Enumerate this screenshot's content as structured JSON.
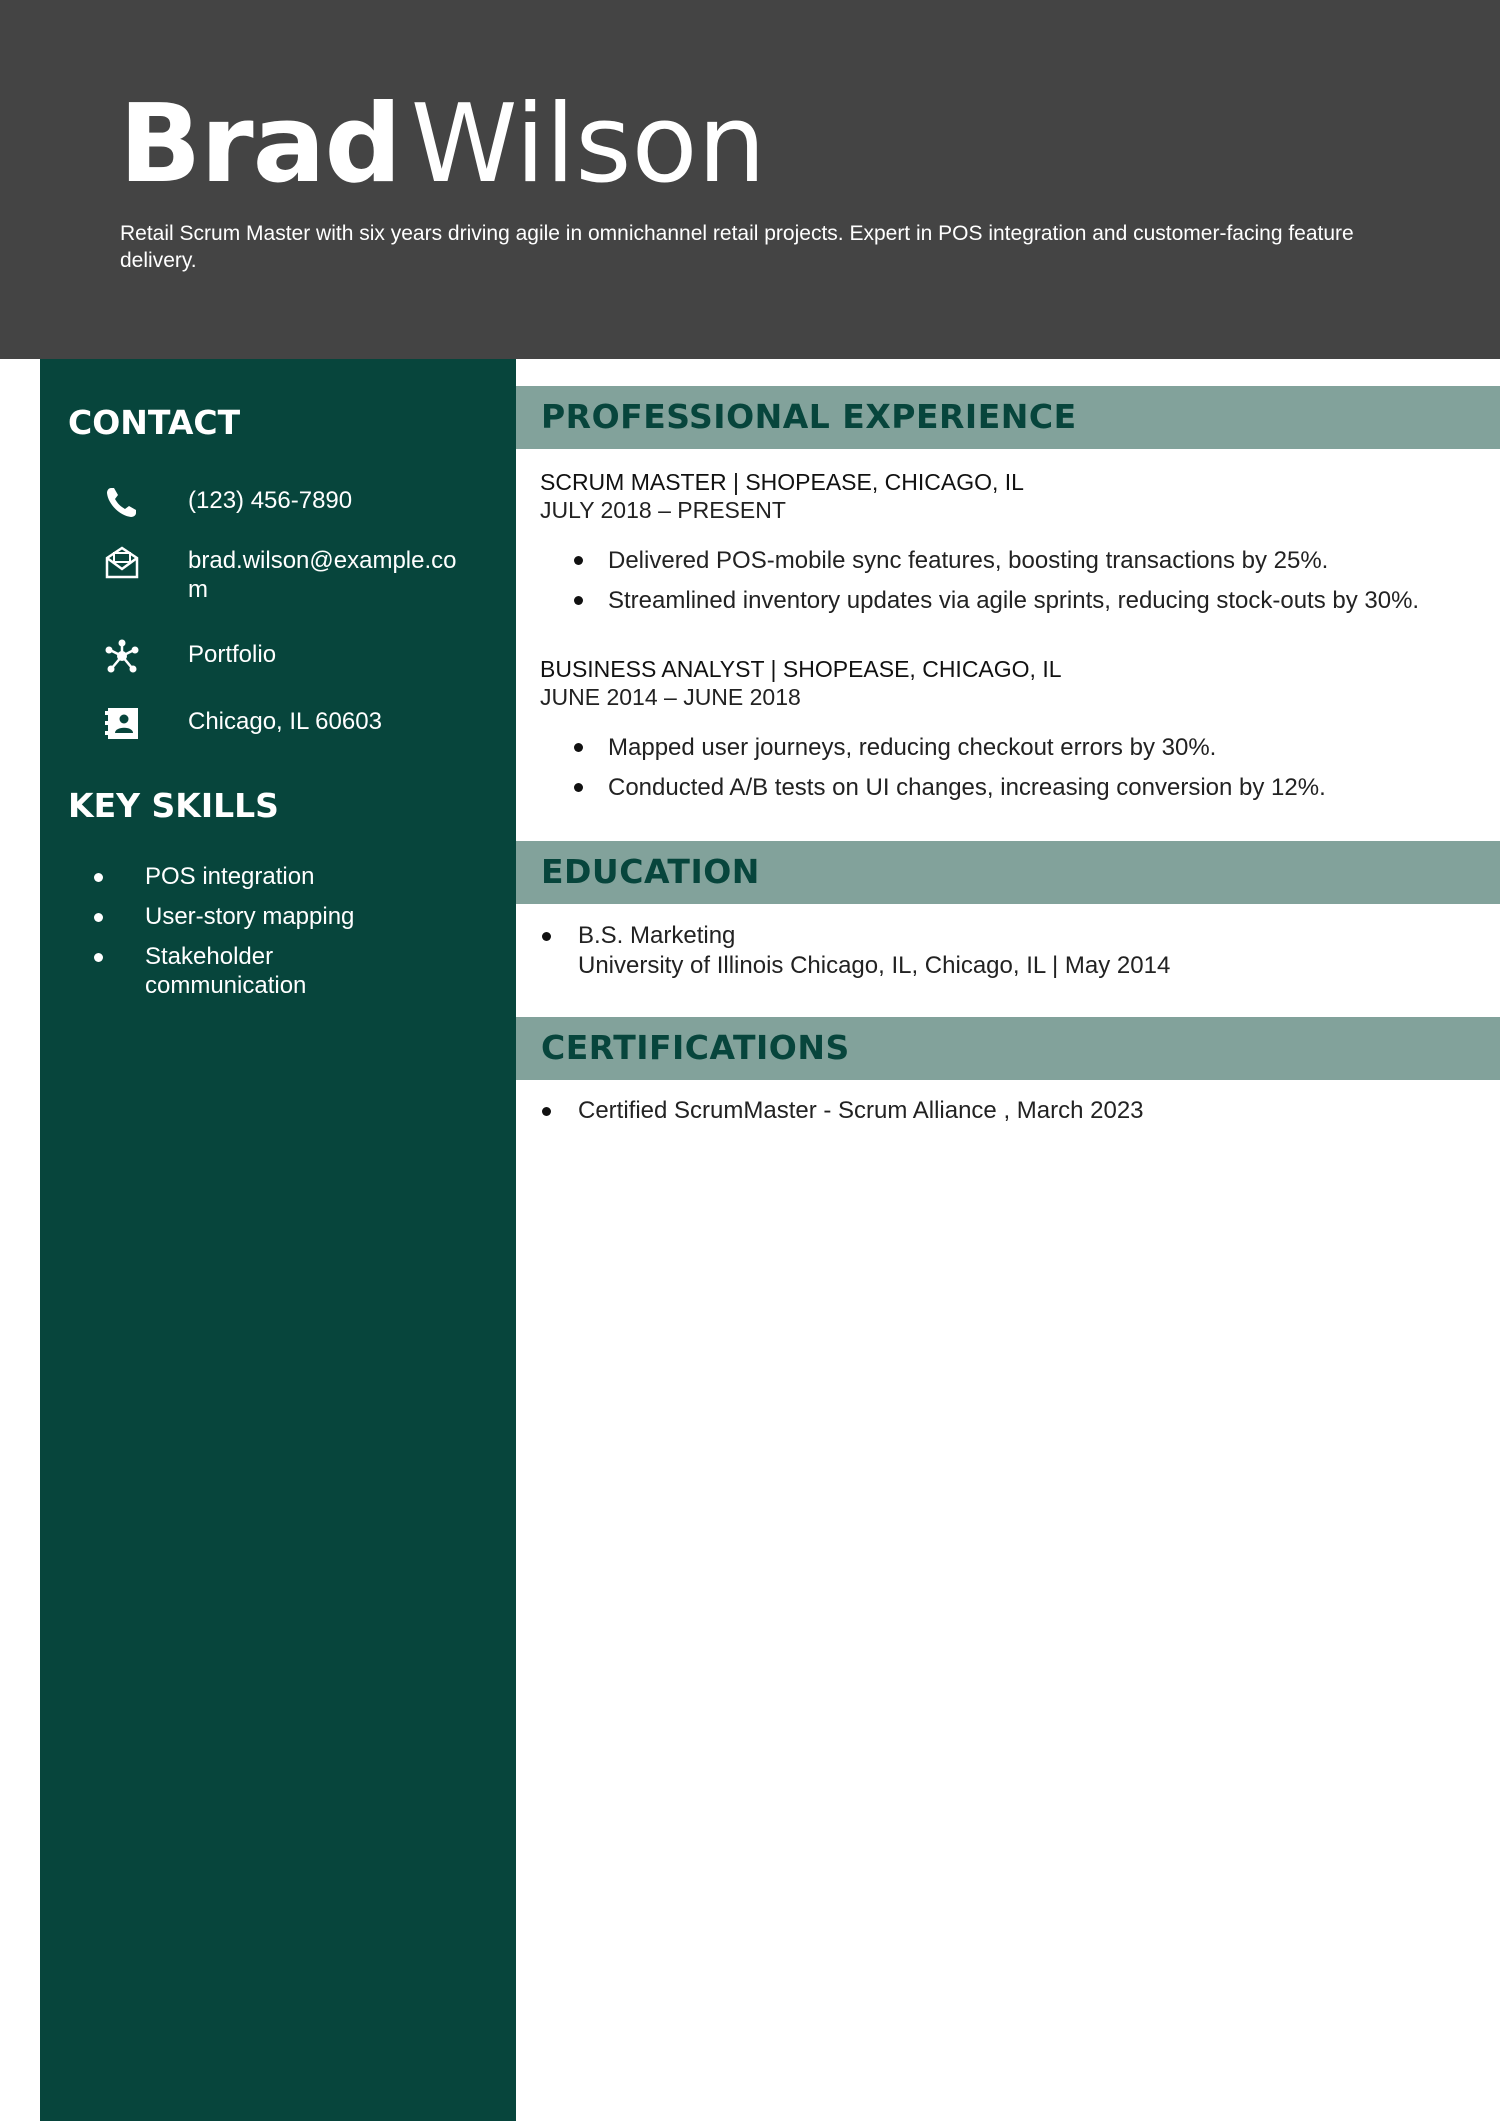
{
  "header": {
    "first_name": "Brad",
    "last_name": "Wilson",
    "summary": "Retail Scrum Master with six years driving agile in omnichannel retail projects. Expert in POS integration and customer-facing feature delivery."
  },
  "sidebar": {
    "contact_heading": "CONTACT",
    "contact": [
      {
        "icon": "phone-icon",
        "text": "(123) 456-7890"
      },
      {
        "icon": "mail-icon",
        "text": "brad.wilson@example.com"
      },
      {
        "icon": "network-icon",
        "text": "Portfolio"
      },
      {
        "icon": "address-card-icon",
        "text": "Chicago, IL 60603"
      }
    ],
    "skills_heading": "KEY SKILLS",
    "skills": [
      "POS integration",
      "User-story mapping",
      "Stakeholder communication"
    ]
  },
  "experience": {
    "heading": "PROFESSIONAL EXPERIENCE",
    "jobs": [
      {
        "role": "SCRUM MASTER | SHOPEASE, CHICAGO, IL",
        "dates": "JULY 2018 – PRESENT",
        "bullets": [
          "Delivered POS-mobile sync features, boosting transactions by 25%.",
          "Streamlined inventory updates via agile sprints, reducing stock-outs by 30%."
        ]
      },
      {
        "role": "BUSINESS ANALYST | SHOPEASE, CHICAGO, IL",
        "dates": "JUNE 2014 – JUNE 2018",
        "bullets": [
          "Mapped user journeys, reducing checkout errors by 30%.",
          "Conducted A/B tests on UI changes, increasing conversion by 12%."
        ]
      }
    ]
  },
  "education": {
    "heading": "EDUCATION",
    "degree": "B.S. Marketing",
    "school": "University of Illinois Chicago, IL, Chicago, IL | May 2014"
  },
  "certifications": {
    "heading": "CERTIFICATIONS",
    "items": [
      "Certified ScrumMaster - Scrum Alliance , March 2023"
    ]
  },
  "colors": {
    "header_bg": "#444444",
    "sidebar_bg": "#07453c",
    "section_bar_bg": "#82a29b",
    "section_text": "#07453c"
  }
}
